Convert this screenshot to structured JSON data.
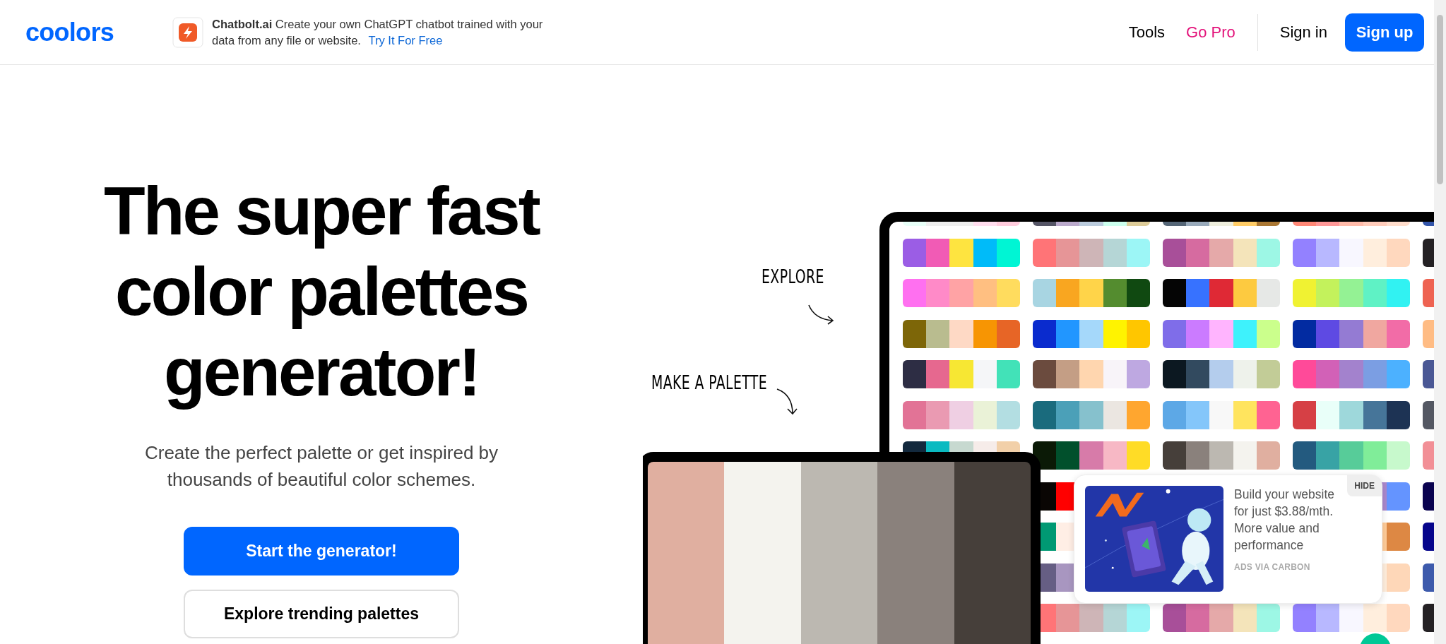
{
  "header": {
    "logo": "coolors",
    "ad": {
      "text": "**Chatbolt.ai**  Create your own ChatGPT chatbot trained with your data from any file or website.",
      "link": "Try It For Free"
    },
    "nav": [
      {
        "label": "Tools",
        "kind": "plain"
      },
      {
        "label": "Go Pro",
        "kind": "pro"
      }
    ],
    "sign_in": "Sign in",
    "sign_up": "Sign up"
  },
  "hero": {
    "title_lines": [
      "The super fast",
      "color palettes",
      "generator!"
    ],
    "subtitle": "Create the perfect palette or get inspired by thousands of beautiful color schemes.",
    "buttons": [
      {
        "label": "Start the generator!",
        "kind": "primary"
      },
      {
        "label": "Explore trending palettes",
        "kind": "secondary"
      }
    ]
  },
  "illustration": {
    "notes": [
      "EXPLORE",
      "MAKE A PALETTE"
    ]
  },
  "carbon_ad": {
    "hide": "HIDE",
    "text": "Build your website for just $3.88/mth. More value and performance",
    "footer": "ADS VIA CARBON"
  }
}
